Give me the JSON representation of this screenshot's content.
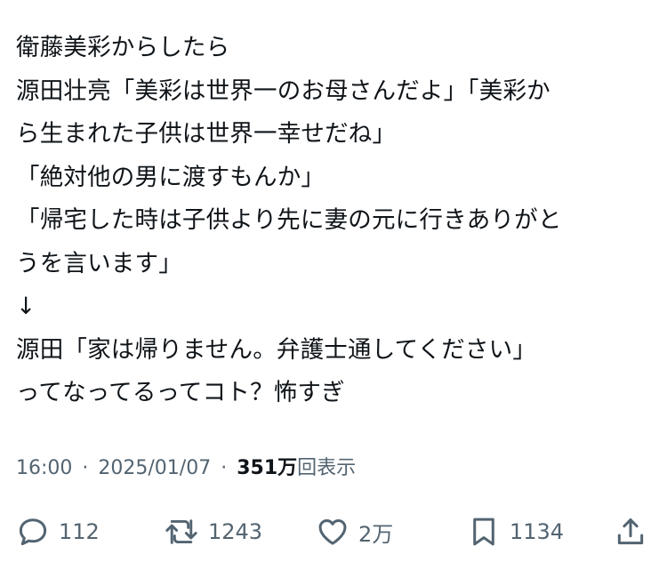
{
  "tweet": {
    "lines": [
      "衛藤美彩からしたら",
      "源田壮亮「美彩は世界一のお母さんだよ」「美彩か",
      "ら生まれた子供は世界一幸せだね」",
      "「絶対他の男に渡すもんか」",
      "「帰宅した時は子供より先に妻の元に行きありがと",
      "うを言います」",
      "↓",
      "源田「家は帰りません。弁護士通してください」",
      "ってなってるってコト？怖すぎ"
    ]
  },
  "meta": {
    "time": "16:00",
    "separator": "·",
    "date": "2025/01/07",
    "views_count": "351万",
    "views_label": "回表示"
  },
  "actions": {
    "reply_count": "112",
    "retweet_count": "1243",
    "like_count": "2万",
    "bookmark_count": "1134",
    "icon_color": "#536471"
  }
}
